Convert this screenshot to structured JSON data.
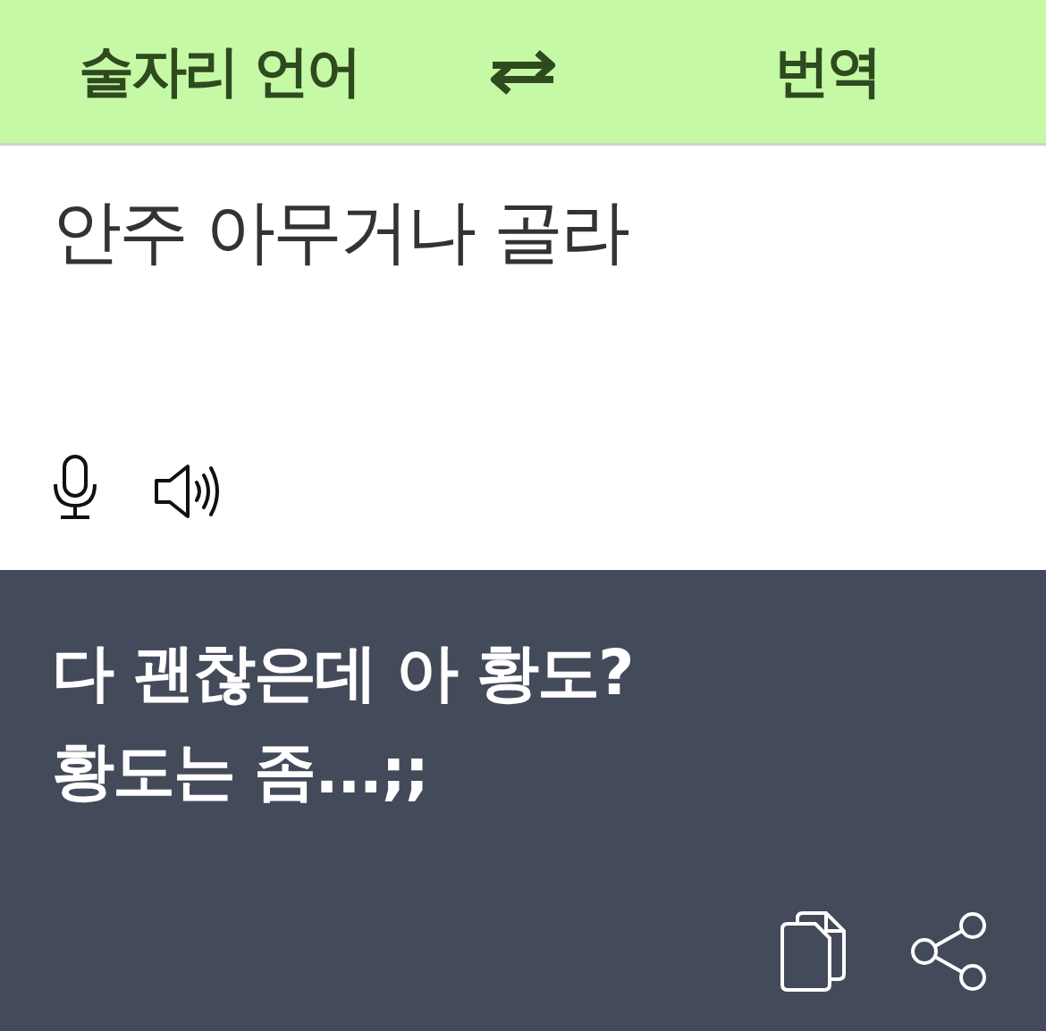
{
  "header": {
    "source_language": "술자리 언어",
    "target_language": "번역"
  },
  "input": {
    "value": "안주 아무거나 골라"
  },
  "output": {
    "lines": [
      "다 괜찮은데 아 황도?",
      "황도는 좀...;;"
    ]
  }
}
